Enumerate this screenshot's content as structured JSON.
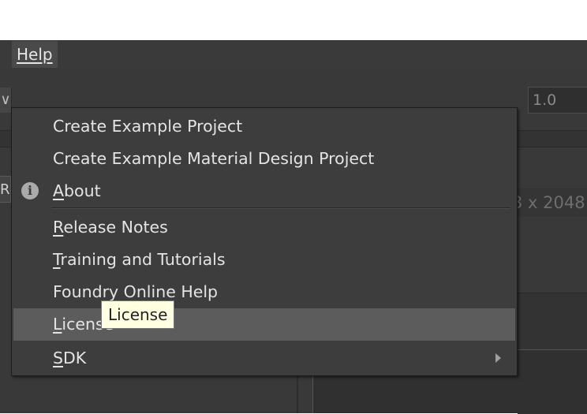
{
  "menubar": {
    "help_label": "Help"
  },
  "background": {
    "left_chevron": "∨",
    "left_letter": "R",
    "scale_value": "1.0",
    "format_text": "3 x 2048"
  },
  "help_menu": {
    "items": [
      {
        "label": "Create Example Project"
      },
      {
        "label": "Create Example Material Design Project"
      },
      {
        "label_mnemonic": "A",
        "label_rest": "bout",
        "icon": "info-icon"
      },
      {
        "label_mnemonic": "R",
        "label_rest": "elease Notes"
      },
      {
        "label_mnemonic": "T",
        "label_rest": "raining and Tutorials"
      },
      {
        "label": "Foundry Online Help"
      },
      {
        "label_mnemonic": "L",
        "label_rest": "icense",
        "highlighted": true
      },
      {
        "label_mnemonic": "S",
        "label_rest": "DK",
        "submenu": true,
        "icon": "chevron-right-icon"
      }
    ]
  },
  "tooltip": {
    "text": "License"
  }
}
